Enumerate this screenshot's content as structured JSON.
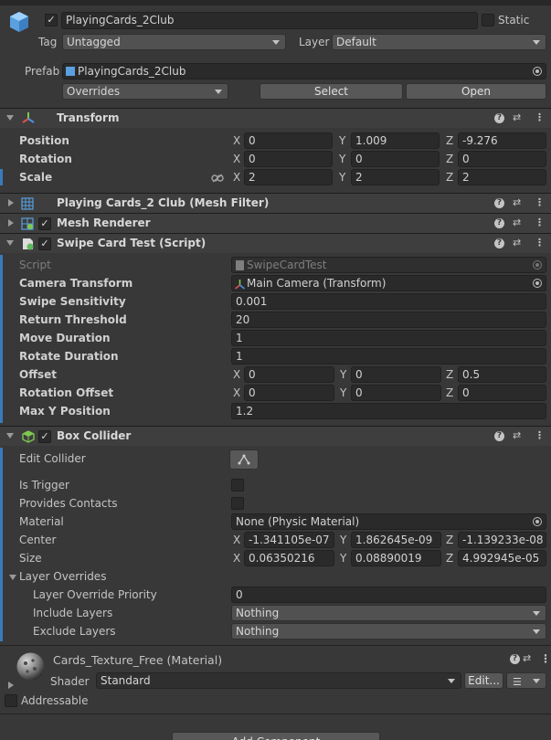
{
  "header": {
    "object_name": "PlayingCards_2Club",
    "static_label": "Static",
    "tag_label": "Tag",
    "tag_value": "Untagged",
    "layer_label": "Layer",
    "layer_value": "Default",
    "prefab_label": "Prefab",
    "prefab_value": "PlayingCards_2Club",
    "overrides_value": "Overrides",
    "select_button": "Select",
    "open_button": "Open"
  },
  "transform": {
    "title": "Transform",
    "rows": [
      {
        "label": "Position",
        "x": "0",
        "y": "1.009",
        "z": "-9.276"
      },
      {
        "label": "Rotation",
        "x": "0",
        "y": "0",
        "z": "0"
      },
      {
        "label": "Scale",
        "x": "2",
        "y": "2",
        "z": "2"
      }
    ]
  },
  "axes": {
    "x": "X",
    "y": "Y",
    "z": "Z"
  },
  "mesh_filter": {
    "title": "Playing Cards_2 Club (Mesh Filter)"
  },
  "mesh_renderer": {
    "title": "Mesh Renderer"
  },
  "swipe": {
    "title": "Swipe Card Test (Script)",
    "script_label": "Script",
    "script_value": "SwipeCardTest",
    "camera_label": "Camera Transform",
    "camera_value": "Main Camera (Transform)",
    "sensitivity_label": "Swipe Sensitivity",
    "sensitivity_value": "0.001",
    "return_label": "Return Threshold",
    "return_value": "20",
    "move_label": "Move Duration",
    "move_value": "1",
    "rotate_label": "Rotate Duration",
    "rotate_value": "1",
    "offset_label": "Offset",
    "offset": {
      "x": "0",
      "y": "0",
      "z": "0.5"
    },
    "rot_offset_label": "Rotation Offset",
    "rot_offset": {
      "x": "0",
      "y": "0",
      "z": "0"
    },
    "maxy_label": "Max Y Position",
    "maxy_value": "1.2"
  },
  "box": {
    "title": "Box Collider",
    "edit_label": "Edit Collider",
    "trigger_label": "Is Trigger",
    "contacts_label": "Provides Contacts",
    "material_label": "Material",
    "material_value": "None (Physic Material)",
    "center_label": "Center",
    "center": {
      "x": "-1.341105e-07",
      "y": "1.862645e-09",
      "z": "-1.139233e-08"
    },
    "size_label": "Size",
    "size": {
      "x": "0.06350216",
      "y": "0.08890019",
      "z": "4.992945e-05"
    },
    "overrides_label": "Layer Overrides",
    "priority_label": "Layer Override Priority",
    "priority_value": "0",
    "include_label": "Include Layers",
    "include_value": "Nothing",
    "exclude_label": "Exclude Layers",
    "exclude_value": "Nothing"
  },
  "material": {
    "name": "Cards_Texture_Free",
    "type": "(Material)",
    "shader_label": "Shader",
    "shader_value": "Standard",
    "edit_button": "Edit...",
    "addressable_label": "Addressable"
  },
  "add_component": "Add Component"
}
